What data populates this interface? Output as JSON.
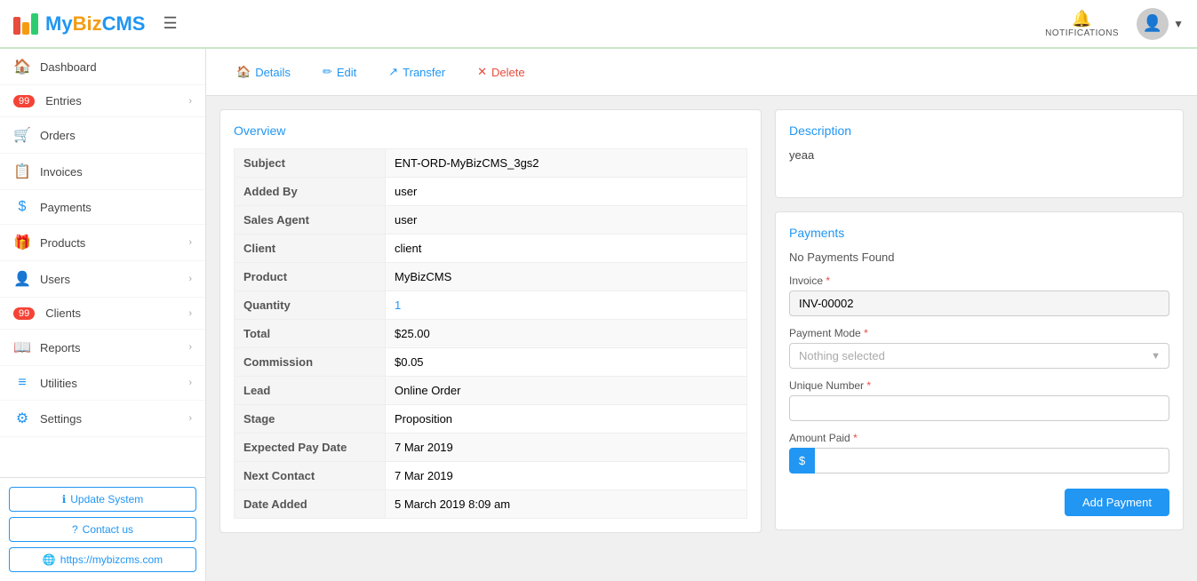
{
  "app": {
    "name": "MyBizCMS",
    "brand_my": "My",
    "brand_biz": "Biz",
    "brand_cms": "CMS"
  },
  "navbar": {
    "notifications_label": "NOTIFICATIONS",
    "hamburger_label": "☰"
  },
  "sidebar": {
    "items": [
      {
        "id": "dashboard",
        "label": "Dashboard",
        "icon": "🏠",
        "badge": null,
        "arrow": false
      },
      {
        "id": "entries",
        "label": "Entries",
        "icon": "99",
        "badge": "99",
        "arrow": true
      },
      {
        "id": "orders",
        "label": "Orders",
        "icon": "🛒",
        "badge": null,
        "arrow": false
      },
      {
        "id": "invoices",
        "label": "Invoices",
        "icon": "📋",
        "badge": null,
        "arrow": false
      },
      {
        "id": "payments",
        "label": "Payments",
        "icon": "$",
        "badge": null,
        "arrow": false
      },
      {
        "id": "products",
        "label": "Products",
        "icon": "🎁",
        "badge": null,
        "arrow": true
      },
      {
        "id": "users",
        "label": "Users",
        "icon": "👤",
        "badge": null,
        "arrow": true
      },
      {
        "id": "clients",
        "label": "Clients",
        "icon": "99",
        "badge": "99",
        "arrow": true
      },
      {
        "id": "reports",
        "label": "Reports",
        "icon": "📖",
        "badge": null,
        "arrow": true
      },
      {
        "id": "utilities",
        "label": "Utilities",
        "icon": "☰",
        "badge": null,
        "arrow": true
      },
      {
        "id": "settings",
        "label": "Settings",
        "icon": "⚙",
        "badge": null,
        "arrow": true
      }
    ],
    "footer": {
      "update_label": "Update System",
      "contact_label": "Contact us",
      "website_label": "https://mybizcms.com"
    }
  },
  "toolbar": {
    "details_label": "Details",
    "edit_label": "Edit",
    "transfer_label": "Transfer",
    "delete_label": "Delete"
  },
  "overview": {
    "title": "Overview",
    "fields": [
      {
        "label": "Subject",
        "value": "ENT-ORD-MyBizCMS_3gs2"
      },
      {
        "label": "Added By",
        "value": "user"
      },
      {
        "label": "Sales Agent",
        "value": "user"
      },
      {
        "label": "Client",
        "value": "client"
      },
      {
        "label": "Product",
        "value": "MyBizCMS"
      },
      {
        "label": "Quantity",
        "value": "1",
        "link": true
      },
      {
        "label": "Total",
        "value": "$25.00"
      },
      {
        "label": "Commission",
        "value": "$0.05"
      },
      {
        "label": "Lead",
        "value": "Online Order"
      },
      {
        "label": "Stage",
        "value": "Proposition"
      },
      {
        "label": "Expected Pay Date",
        "value": "7 Mar 2019"
      },
      {
        "label": "Next Contact",
        "value": "7 Mar 2019"
      },
      {
        "label": "Date Added",
        "value": "5 March 2019 8:09 am"
      }
    ]
  },
  "description": {
    "title": "Description",
    "text": "yeaa"
  },
  "payments": {
    "title": "Payments",
    "no_payments_text": "No Payments Found",
    "invoice_label": "Invoice",
    "invoice_value": "INV-00002",
    "payment_mode_label": "Payment Mode",
    "payment_mode_placeholder": "Nothing selected",
    "unique_number_label": "Unique Number",
    "unique_number_placeholder": "",
    "amount_paid_label": "Amount Paid",
    "amount_paid_prefix": "$",
    "add_payment_label": "Add Payment"
  }
}
